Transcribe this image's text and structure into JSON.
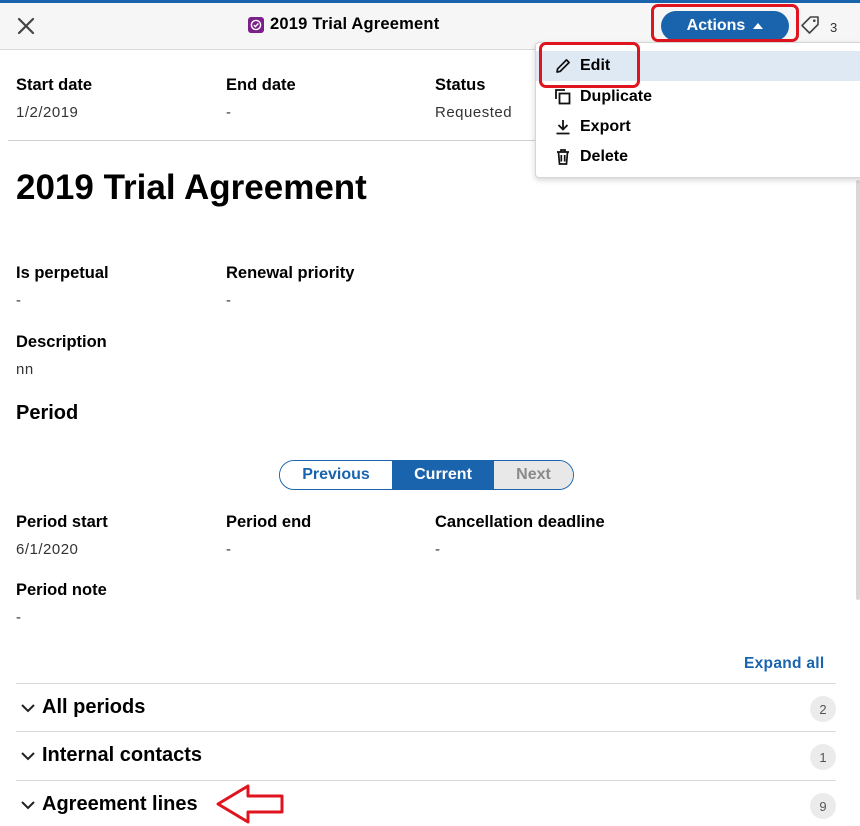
{
  "header": {
    "title": "2019 Trial Agreement",
    "actions_label": "Actions",
    "tag_count": "3",
    "accent": "#1a64ae"
  },
  "actions_menu": {
    "items": [
      {
        "label": "Edit",
        "icon": "pencil-icon"
      },
      {
        "label": "Duplicate",
        "icon": "duplicate-icon"
      },
      {
        "label": "Export",
        "icon": "download-icon"
      },
      {
        "label": "Delete",
        "icon": "trash-icon"
      }
    ]
  },
  "summary": {
    "start_date_label": "Start date",
    "start_date_value": "1/2/2019",
    "end_date_label": "End date",
    "end_date_value": "-",
    "status_label": "Status",
    "status_value": "Requested"
  },
  "agreement": {
    "title": "2019 Trial Agreement",
    "is_perpetual_label": "Is perpetual",
    "is_perpetual_value": "-",
    "renewal_priority_label": "Renewal priority",
    "renewal_priority_value": "-",
    "description_label": "Description",
    "description_value": "nn"
  },
  "period": {
    "section_title": "Period",
    "nav": {
      "previous": "Previous",
      "current": "Current",
      "next": "Next",
      "selected": "Current"
    },
    "period_start_label": "Period start",
    "period_start_value": "6/1/2020",
    "period_end_label": "Period end",
    "period_end_value": "-",
    "cancellation_deadline_label": "Cancellation deadline",
    "cancellation_deadline_value": "-",
    "period_note_label": "Period note",
    "period_note_value": "-"
  },
  "accordions": {
    "expand_all_label": "Expand all",
    "items": [
      {
        "title": "All periods",
        "count": "2"
      },
      {
        "title": "Internal contacts",
        "count": "1"
      },
      {
        "title": "Agreement lines",
        "count": "9"
      }
    ]
  },
  "annotation_color": "#e0141e"
}
